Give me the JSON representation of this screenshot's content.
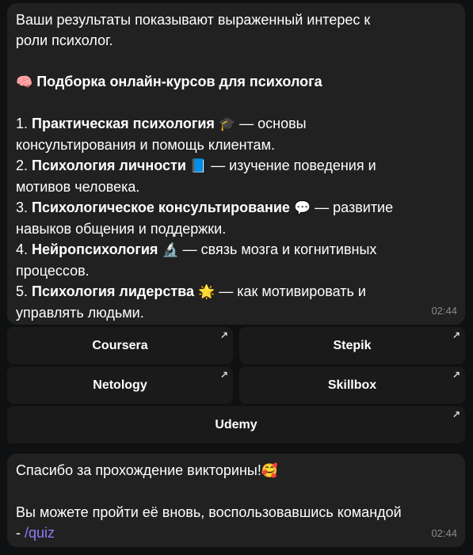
{
  "messages": [
    {
      "intro": "Ваши результаты показывают выраженный интерес к",
      "intro2": "роли психолог.",
      "heading_emoji": "🧠",
      "heading": "Подборка онлайн-курсов для психолога",
      "courses": [
        {
          "num": "1.",
          "title": "Практическая психология",
          "emoji": "🎓",
          "desc1": "— основы",
          "desc2": "консультирования и помощь клиентам."
        },
        {
          "num": "2.",
          "title": "Психология личности",
          "emoji": "📘",
          "desc1": "— изучение поведения и",
          "desc2": "мотивов человека."
        },
        {
          "num": "3.",
          "title": "Психологическое консультирование",
          "emoji": "💬",
          "desc1": "— развитие",
          "desc2": "навыков общения и поддержки."
        },
        {
          "num": "4.",
          "title": "Нейропсихология",
          "emoji": "🔬",
          "desc1": "— связь мозга и когнитивных",
          "desc2": "процессов."
        },
        {
          "num": "5.",
          "title": "Психология лидерства",
          "emoji": "🌟",
          "desc1": "— как мотивировать и",
          "desc2": "управлять людьми."
        }
      ],
      "time": "02:44"
    },
    {
      "line1": "Спасибо за прохождение викторины!",
      "line1_emoji": "🥰",
      "line2": "Вы можете пройти её вновь, воспользовавшись командой",
      "line3_prefix": "- ",
      "command": "/quiz",
      "time": "02:44"
    }
  ],
  "inline_buttons": [
    [
      "Coursera",
      "Stepik"
    ],
    [
      "Netology",
      "Skillbox"
    ],
    [
      "Udemy"
    ]
  ],
  "arrow_icon": "↗"
}
